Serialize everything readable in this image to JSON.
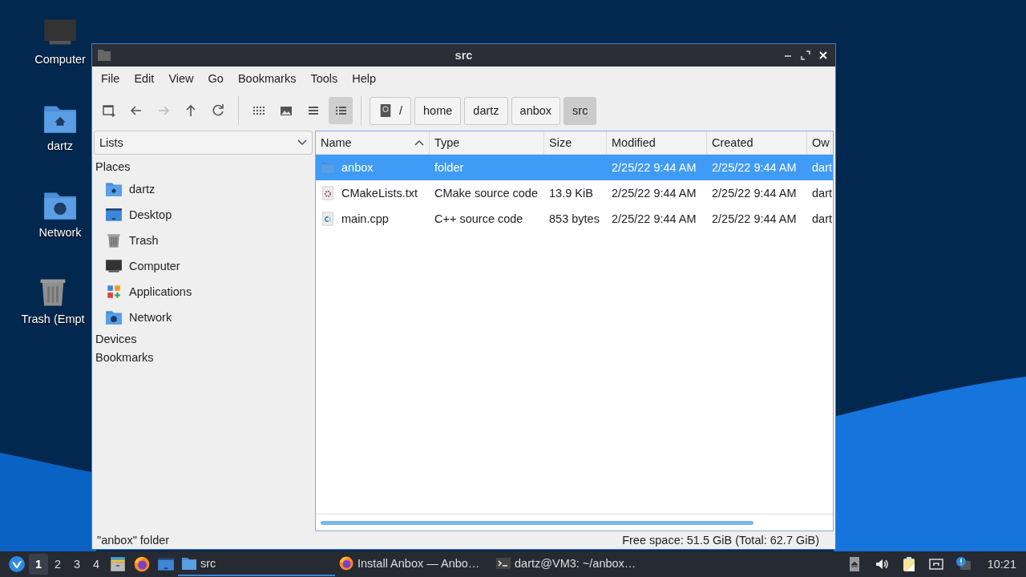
{
  "desktop_icons": [
    {
      "label": "Computer",
      "kind": "computer"
    },
    {
      "label": "dartz",
      "kind": "home"
    },
    {
      "label": "Network",
      "kind": "network"
    },
    {
      "label": "Trash (Empt",
      "kind": "trash"
    }
  ],
  "window": {
    "title": "src",
    "menu": [
      "File",
      "Edit",
      "View",
      "Go",
      "Bookmarks",
      "Tools",
      "Help"
    ],
    "nav_buttons": [
      {
        "kind": "new-tab",
        "disabled": false
      },
      {
        "kind": "back",
        "disabled": false
      },
      {
        "kind": "forward",
        "disabled": true
      },
      {
        "kind": "up",
        "disabled": false
      },
      {
        "kind": "reload",
        "disabled": false
      }
    ],
    "view_buttons": [
      {
        "kind": "icons",
        "selected": false
      },
      {
        "kind": "thumbnails",
        "selected": false
      },
      {
        "kind": "compact",
        "selected": false
      },
      {
        "kind": "details",
        "selected": true
      }
    ],
    "path": [
      {
        "label": "/",
        "selected": false
      },
      {
        "label": "home",
        "selected": false
      },
      {
        "label": "dartz",
        "selected": false
      },
      {
        "label": "anbox",
        "selected": false
      },
      {
        "label": "src",
        "selected": true
      }
    ],
    "sidebar": {
      "dropdown": "Lists",
      "sections": [
        {
          "label": "Places",
          "items": [
            {
              "label": "dartz",
              "kind": "home"
            },
            {
              "label": "Desktop",
              "kind": "desktop"
            },
            {
              "label": "Trash",
              "kind": "trash"
            },
            {
              "label": "Computer",
              "kind": "computer"
            },
            {
              "label": "Applications",
              "kind": "applications"
            },
            {
              "label": "Network",
              "kind": "network"
            }
          ]
        },
        {
          "label": "Devices"
        },
        {
          "label": "Bookmarks"
        }
      ]
    },
    "table": {
      "columns": [
        {
          "label": "Name",
          "sorted": true
        },
        {
          "label": "Type",
          "sorted": false
        },
        {
          "label": "Size",
          "sorted": false
        },
        {
          "label": "Modified",
          "sorted": false
        },
        {
          "label": "Created",
          "sorted": false
        },
        {
          "label": "Ow",
          "sorted": false
        }
      ],
      "rows": [
        {
          "kind": "folder",
          "selected": true,
          "cells": [
            "anbox",
            "folder",
            "",
            "2/25/22 9:44 AM",
            "2/25/22 9:44 AM",
            "dart"
          ]
        },
        {
          "kind": "cmake",
          "selected": false,
          "cells": [
            "CMakeLists.txt",
            "CMake source code",
            "13.9 KiB",
            "2/25/22 9:44 AM",
            "2/25/22 9:44 AM",
            "dart"
          ]
        },
        {
          "kind": "cpp",
          "selected": false,
          "cells": [
            "main.cpp",
            "C++ source code",
            "853 bytes",
            "2/25/22 9:44 AM",
            "2/25/22 9:44 AM",
            "dart"
          ]
        }
      ]
    },
    "status_bar": {
      "selection": "\"anbox\" folder",
      "free_space": "Free space: 51.5 GiB (Total: 62.7 GiB)"
    }
  },
  "taskbar": {
    "workspaces": [
      {
        "label": "1",
        "selected": true
      },
      {
        "label": "2",
        "selected": false
      },
      {
        "label": "3",
        "selected": false
      },
      {
        "label": "4",
        "selected": false
      }
    ],
    "launchers": [
      {
        "kind": "file-manager"
      },
      {
        "kind": "browser"
      },
      {
        "kind": "desktop"
      }
    ],
    "tasks": [
      {
        "label": "src",
        "kind": "folder",
        "selected": true
      },
      {
        "label": "Install Anbox — Anbo…",
        "kind": "browser",
        "selected": false
      },
      {
        "label": "dartz@VM3: ~/anbox…",
        "kind": "terminal",
        "selected": false
      }
    ],
    "tray": [
      {
        "kind": "eject"
      },
      {
        "kind": "volume"
      },
      {
        "kind": "clipboard"
      },
      {
        "kind": "network"
      },
      {
        "kind": "notification"
      }
    ],
    "clock": "10:21"
  }
}
